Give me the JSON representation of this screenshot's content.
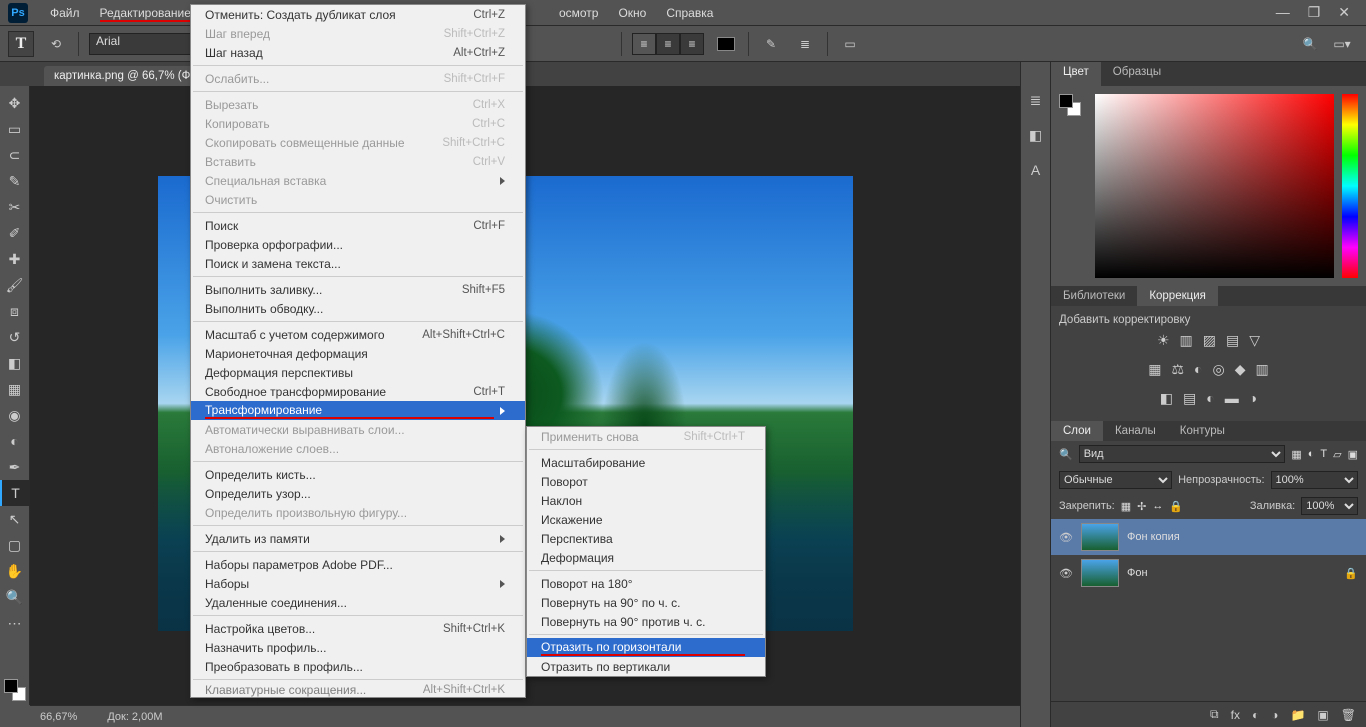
{
  "menubar": {
    "items": [
      "Файл",
      "Редактирование",
      "Просмотр",
      "Окно",
      "Справка"
    ],
    "gap_after": 1,
    "gap_label_visible": "осмотр"
  },
  "optionsbar": {
    "font": "Arial"
  },
  "tab": {
    "label": "картинка.png @ 66,7% (Ф"
  },
  "status": {
    "zoom": "66,67%",
    "doc": "Док: 2,00M"
  },
  "right": {
    "color_tabs": [
      "Цвет",
      "Образцы"
    ],
    "lib_tabs": [
      "Библиотеки",
      "Коррекция"
    ],
    "adj_title": "Добавить корректировку",
    "layer_tabs": [
      "Слои",
      "Каналы",
      "Контуры"
    ],
    "layer_filter": "Вид",
    "blend_mode": "Обычные",
    "opacity_label": "Непрозрачность:",
    "opacity_val": "100%",
    "lock_label": "Закрепить:",
    "fill_label": "Заливка:",
    "fill_val": "100%",
    "layer1": "Фон копия",
    "layer2": "Фон"
  },
  "edit_menu": [
    {
      "label": "Отменить: Создать дубликат слоя",
      "shortcut": "Ctrl+Z"
    },
    {
      "label": "Шаг вперед",
      "shortcut": "Shift+Ctrl+Z",
      "disabled": true
    },
    {
      "label": "Шаг назад",
      "shortcut": "Alt+Ctrl+Z"
    },
    {
      "sep": true
    },
    {
      "label": "Ослабить...",
      "shortcut": "Shift+Ctrl+F",
      "disabled": true
    },
    {
      "sep": true
    },
    {
      "label": "Вырезать",
      "shortcut": "Ctrl+X",
      "disabled": true
    },
    {
      "label": "Копировать",
      "shortcut": "Ctrl+C",
      "disabled": true
    },
    {
      "label": "Скопировать совмещенные данные",
      "shortcut": "Shift+Ctrl+C",
      "disabled": true
    },
    {
      "label": "Вставить",
      "shortcut": "Ctrl+V",
      "disabled": true
    },
    {
      "label": "Специальная вставка",
      "sub": true,
      "disabled": true
    },
    {
      "label": "Очистить",
      "disabled": true
    },
    {
      "sep": true
    },
    {
      "label": "Поиск",
      "shortcut": "Ctrl+F"
    },
    {
      "label": "Проверка орфографии..."
    },
    {
      "label": "Поиск и замена текста..."
    },
    {
      "sep": true
    },
    {
      "label": "Выполнить заливку...",
      "shortcut": "Shift+F5"
    },
    {
      "label": "Выполнить обводку..."
    },
    {
      "sep": true
    },
    {
      "label": "Масштаб с учетом содержимого",
      "shortcut": "Alt+Shift+Ctrl+C"
    },
    {
      "label": "Марионеточная деформация"
    },
    {
      "label": "Деформация перспективы"
    },
    {
      "label": "Свободное трансформирование",
      "shortcut": "Ctrl+T"
    },
    {
      "label": "Трансформирование",
      "sub": true,
      "hl": true,
      "rl": true
    },
    {
      "label": "Автоматически выравнивать слои...",
      "disabled": true
    },
    {
      "label": "Автоналожение слоев...",
      "disabled": true
    },
    {
      "sep": true
    },
    {
      "label": "Определить кисть..."
    },
    {
      "label": "Определить узор..."
    },
    {
      "label": "Определить произвольную фигуру...",
      "disabled": true
    },
    {
      "sep": true
    },
    {
      "label": "Удалить из памяти",
      "sub": true
    },
    {
      "sep": true
    },
    {
      "label": "Наборы параметров Adobe PDF..."
    },
    {
      "label": "Наборы",
      "sub": true
    },
    {
      "label": "Удаленные соединения..."
    },
    {
      "sep": true
    },
    {
      "label": "Настройка цветов...",
      "shortcut": "Shift+Ctrl+K"
    },
    {
      "label": "Назначить профиль..."
    },
    {
      "label": "Преобразовать в профиль..."
    },
    {
      "sep": true
    },
    {
      "label": "Клавиатурные сокращения...",
      "shortcut": "Alt+Shift+Ctrl+K",
      "cut": true
    }
  ],
  "transform_submenu": [
    {
      "label": "Применить снова",
      "shortcut": "Shift+Ctrl+T",
      "disabled": true
    },
    {
      "sep": true
    },
    {
      "label": "Масштабирование"
    },
    {
      "label": "Поворот"
    },
    {
      "label": "Наклон"
    },
    {
      "label": "Искажение"
    },
    {
      "label": "Перспектива"
    },
    {
      "label": "Деформация"
    },
    {
      "sep": true
    },
    {
      "label": "Поворот на 180°"
    },
    {
      "label": "Повернуть на 90° по ч. с."
    },
    {
      "label": "Повернуть на 90° против ч. с."
    },
    {
      "sep": true
    },
    {
      "label": "Отразить по горизонтали",
      "hl": true,
      "rl": true
    },
    {
      "label": "Отразить по вертикали"
    }
  ]
}
